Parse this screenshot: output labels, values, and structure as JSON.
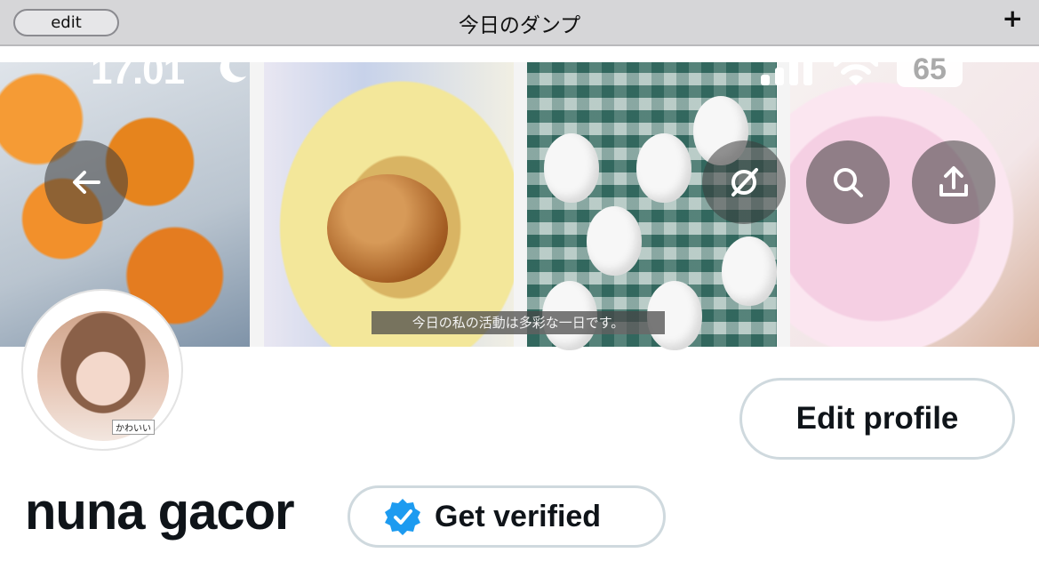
{
  "app_strip": {
    "edit_label": "edit",
    "title": "今日のダンプ",
    "add_label": "+"
  },
  "status_bar": {
    "time": "17.01",
    "battery": "65"
  },
  "banner": {
    "caption": "今日の私の活動は多彩な一日です。"
  },
  "overlay_buttons": {
    "back": "arrow-left-icon",
    "hide": "eye-slash-icon",
    "search": "search-icon",
    "share": "share-icon"
  },
  "profile": {
    "avatar_tag": "かわいい",
    "edit_profile_label": "Edit profile",
    "name": "nuna gacor",
    "get_verified_label": "Get verified"
  },
  "colors": {
    "verified_badge": "#1d9bf0",
    "text_primary": "#0f1419",
    "button_border": "#cfd9de"
  }
}
